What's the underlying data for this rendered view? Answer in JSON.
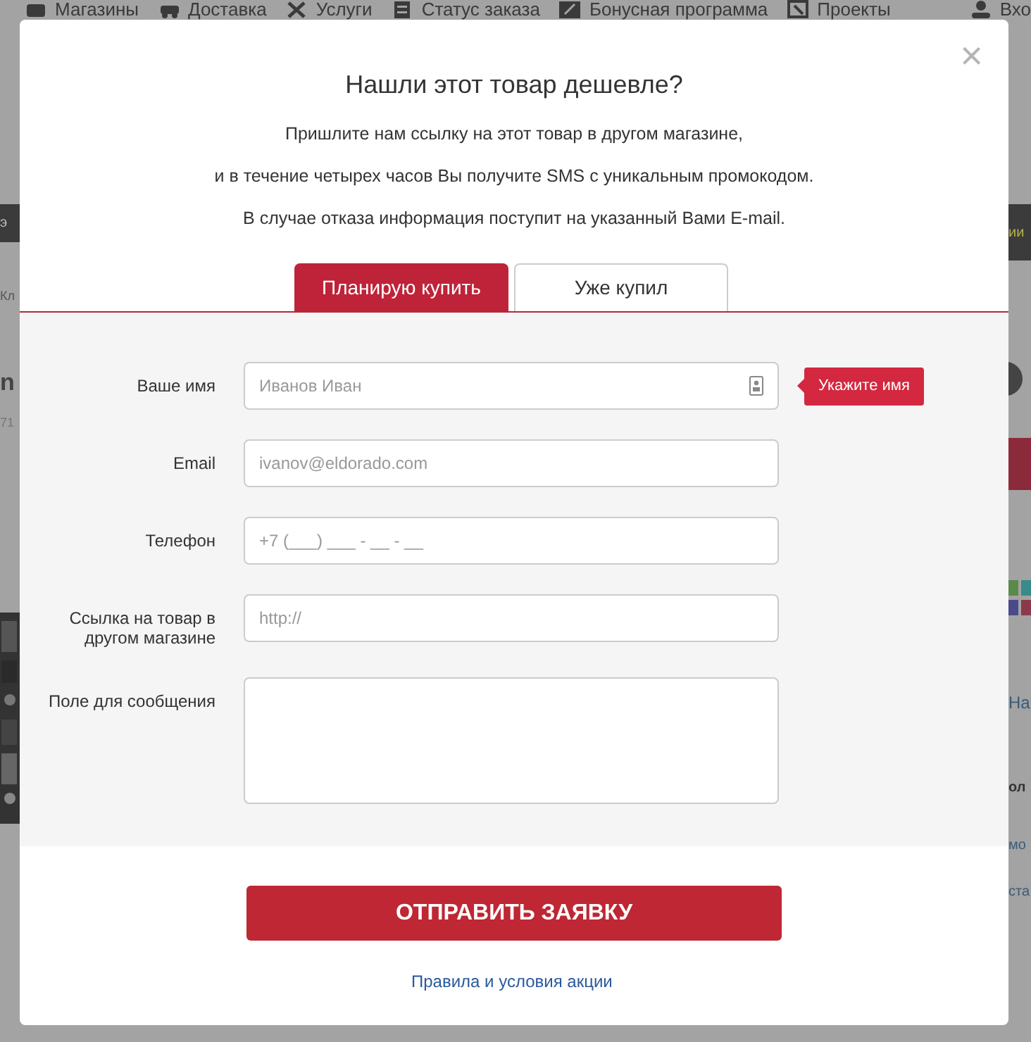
{
  "background": {
    "nav": [
      "Магазины",
      "Доставка",
      "Услуги",
      "Статус заказа",
      "Бонусная программа",
      "Проекты",
      "Вхо"
    ],
    "left_fragments": [
      "э",
      "Кл",
      "n",
      "71"
    ],
    "right_fragments": [
      "ии",
      "На",
      "ол",
      "мо",
      "ста"
    ]
  },
  "modal": {
    "close": "×",
    "title": "Нашли этот товар дешевле?",
    "lines": [
      "Пришлите нам ссылку на этот товар в другом магазине,",
      "и в течение четырех часов Вы получите SMS с уникальным промокодом.",
      "В случае отказа информация поступит на указанный Вами E-mail."
    ],
    "tabs": [
      {
        "label": "Планирую купить",
        "selected": true
      },
      {
        "label": "Уже купил",
        "selected": false
      }
    ],
    "fields": [
      {
        "kind": "input",
        "label": "Ваше имя",
        "placeholder": "Иванов Иван",
        "contact_icon": true,
        "tooltip": "Укажите имя"
      },
      {
        "kind": "input",
        "label": "Email",
        "placeholder": "ivanov@eldorado.com"
      },
      {
        "kind": "input",
        "label": "Телефон",
        "placeholder": "+7 (___) ___ - __ - __"
      },
      {
        "kind": "input",
        "label": "Ссылка на товар в другом магазине",
        "placeholder": "http://"
      },
      {
        "kind": "textarea",
        "label": "Поле для сообщения"
      }
    ],
    "submit": "ОТПРАВИТЬ ЗАЯВКУ",
    "terms_link": "Правила и условия акции"
  }
}
